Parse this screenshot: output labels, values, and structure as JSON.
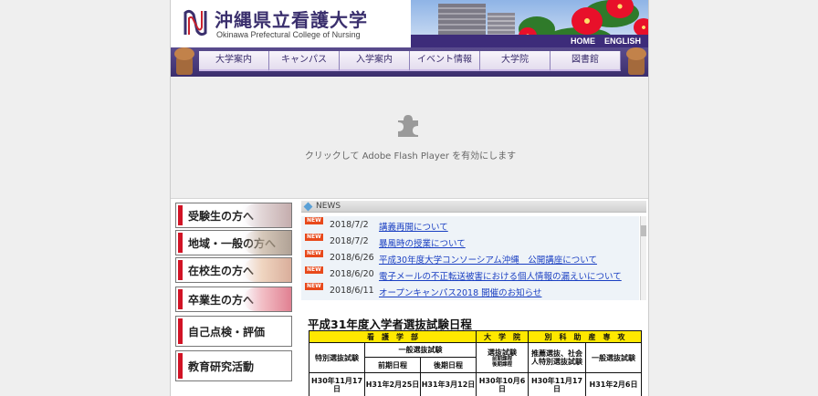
{
  "header": {
    "title_jp": "沖縄県立看護大学",
    "title_en": "Okinawa Prefectural College of Nursing",
    "top_links": [
      "HOME",
      "ENGLISH"
    ]
  },
  "nav": [
    "大学案内",
    "キャンパス",
    "入学案内",
    "イベント情報",
    "大学院",
    "図書館"
  ],
  "flash": {
    "message": "クリックして Adobe Flash Player を有効にします"
  },
  "sidebar": [
    "受験生の方へ",
    "地域・一般の方へ",
    "在校生の方へ",
    "卒業生の方へ",
    "自己点検・評価",
    "教育研究活動"
  ],
  "news": {
    "heading": "NEWS",
    "badge": "NEW",
    "items": [
      {
        "date": "2018/7/2",
        "title": "講義再開について"
      },
      {
        "date": "2018/7/2",
        "title": "暴風時の授業について"
      },
      {
        "date": "2018/6/26",
        "title": "平成30年度大学コンソーシアム沖縄　公開講座について"
      },
      {
        "date": "2018/6/20",
        "title": "電子メールの不正転送被害における個人情報の漏えいについて"
      },
      {
        "date": "2018/6/11",
        "title": "オープンキャンパス2018 開催のお知らせ"
      }
    ]
  },
  "exam": {
    "title": "平成31年度入学者選抜試験日程",
    "group_nursing": "看　護　学　部",
    "group_grad": "大　学　院",
    "group_special": "別　科　助　産　専　攻",
    "col_tokubetsu": "特別選抜試験",
    "col_ippan": "一般選抜試験",
    "col_zenki": "前期日程",
    "col_kouki": "後期日程",
    "col_grad": "選抜試験",
    "col_grad_sub1": "前期課程",
    "col_grad_sub2": "後期課程",
    "col_suisen": "推薦選抜、社会人特別選抜試験",
    "col_special_ippan": "一般選抜試験",
    "dates": [
      "H30年11月17日",
      "H31年2月25日",
      "H31年3月12日",
      "H30年10月6日",
      "H30年11月17日",
      "H31年2月6日"
    ]
  }
}
